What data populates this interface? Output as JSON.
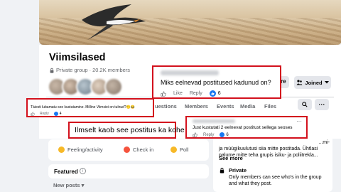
{
  "group": {
    "name": "Viimsilased",
    "privacy": "Private group",
    "members": "20.2K members",
    "share_partial": "re",
    "joined_label": "Joined"
  },
  "tabs": [
    "uestions",
    "Members",
    "Events",
    "Media",
    "Files"
  ],
  "composer": {
    "feeling": "Feeling/activity",
    "checkin": "Check in",
    "poll": "Poll"
  },
  "featured": "Featured",
  "new_posts": "New posts",
  "about": {
    "text": "Just kustutati 2 eelnevat postitust sellega seoses mi- ja müügikuulutusi siia mitte postitada. Ühtlasi palume mitte teha grupis isiku- ja poliitrekla...",
    "visible_line1": "...mi-",
    "visible_line2": "ja müügikuulutusi siia mitte postitada. Ühtlasi",
    "visible_line3": "palume mitte teha grupis isiku- ja poliitrekla...",
    "see_more": "See more",
    "private_title": "Private",
    "private_desc": "Only members can see who's in the group and what they post."
  },
  "comments": {
    "c1": {
      "text": "Miks eelnevad postitused kadunud on?",
      "like": "Like",
      "reply": "Reply",
      "count": "6"
    },
    "c2": {
      "text": "Täiesti lubamatu see kustutamine. Milline Viimsist on tulnud?😶😂",
      "like": "Like",
      "reply": "Reply",
      "count": "4"
    },
    "c3": {
      "text": "Just kustutati 2 eelnevat postitust sellega seoses",
      "like": "Like",
      "reply": "Reply",
      "count": "6",
      "menu": "···"
    }
  },
  "headline": "Ilmselt kaob see postitus ka kohe",
  "colors": {
    "highlight": "#d3111d",
    "like": "#1877f2"
  }
}
